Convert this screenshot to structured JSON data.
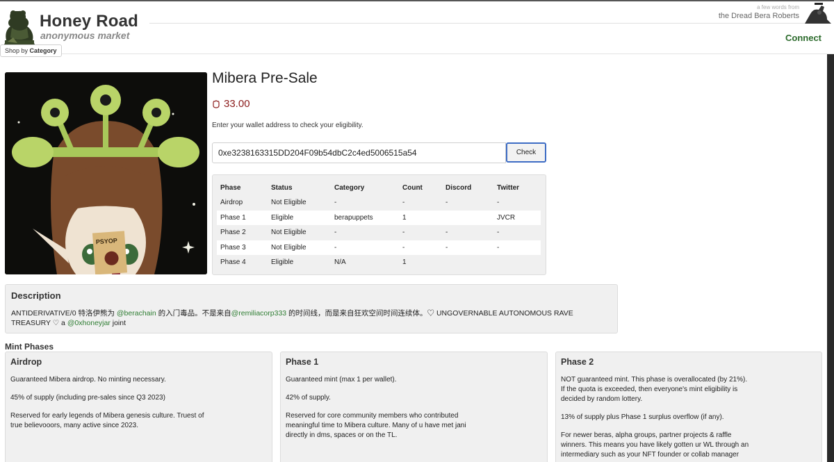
{
  "header": {
    "brand": "Honey Road",
    "tagline": "anonymous market",
    "quote_small": "a few words from",
    "quote_main": "the Dread Bera Roberts",
    "connect_label": "Connect",
    "shop_prefix": "Shop by",
    "shop_label": "Category"
  },
  "product": {
    "title": "Mibera Pre-Sale",
    "price": "33.00",
    "instruction": "Enter your wallet address to check your eligibility.",
    "wallet_value": "0xe3238163315DD204F09b54dbC2c4ed5006515a54",
    "check_label": "Check",
    "card_label": "PSYOP"
  },
  "eligibility": {
    "headers": [
      "Phase",
      "Status",
      "Category",
      "Count",
      "Discord",
      "Twitter"
    ],
    "rows": [
      [
        "Airdrop",
        "Not Eligible",
        "-",
        "-",
        "-",
        "-"
      ],
      [
        "Phase 1",
        "Eligible",
        "berapuppets",
        "1",
        "",
        "JVCR"
      ],
      [
        "Phase 2",
        "Not Eligible",
        "-",
        "-",
        "-",
        "-"
      ],
      [
        "Phase 3",
        "Not Eligible",
        "-",
        "-",
        "-",
        "-"
      ],
      [
        "Phase 4",
        "Eligible",
        "N/A",
        "1",
        "",
        ""
      ]
    ]
  },
  "description": {
    "title": "Description",
    "part1": "ANTIDERIVATIVE/0 特洛伊熊为 ",
    "handle1": "@berachain",
    "part2": " 的入门毒品。不是来自",
    "handle2": "@remiliacorp333",
    "part3": " 的时间线，而是来自狂欢空间时间连续体。♡ UNGOVERNABLE AUTONOMOUS RAVE TREASURY ♡ a ",
    "handle3": "@0xhoneyjar",
    "part4": " joint"
  },
  "mint_phases": {
    "title": "Mint Phases",
    "cards": [
      {
        "title": "Airdrop",
        "paragraphs": [
          "Guaranteed Mibera airdrop. No minting necessary.",
          "45% of supply (including pre-sales since Q3 2023)",
          "Reserved for early legends of Mibera genesis culture. Truest of true believooors, many active since 2023."
        ]
      },
      {
        "title": "Phase 1",
        "paragraphs": [
          "Guaranteed mint (max 1 per wallet).",
          "42% of supply.",
          "Reserved for core community members who contributed meaningful time to Mibera culture. Many of u have met jani directly in dms, spaces or on the TL."
        ]
      },
      {
        "title": "Phase 2",
        "paragraphs": [
          "NOT guaranteed mint. This phase is overallocated (by 21%). If the quota is exceeded, then everyone's mint eligibility is decided by random lottery.",
          "13% of supply plus Phase 1 surplus overflow (if any).",
          "For newer beras, alpha groups, partner projects & raffle winners. This means you have likely gotten ur WL through an intermediary such as your NFT founder or collab manager"
        ]
      }
    ]
  },
  "colors": {
    "eligible": "#2e7d32",
    "price": "#8b1a1a",
    "check_border": "#3d6cc4",
    "panel_bg": "#f0f0f0"
  },
  "icons": [
    "bera-logo-icon",
    "honey-price-icon",
    "bera-portrait-icon"
  ]
}
